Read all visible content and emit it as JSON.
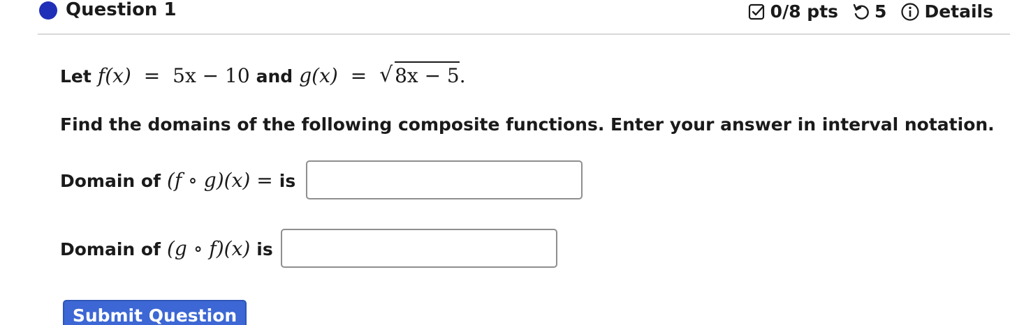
{
  "header": {
    "question_title": "Question 1",
    "points": "0/8 pts",
    "attempts": "5",
    "details": "Details"
  },
  "problem": {
    "intro_let": "Let",
    "f_lhs": "f(x)",
    "eq": "=",
    "f_rhs": "5x − 10",
    "and": "and",
    "g_lhs": "g(x)",
    "g_rhs_radicand": "8x − 5",
    "period": ".",
    "instruction": "Find the domains of the following composite functions. Enter your answer in interval notation."
  },
  "questions": [
    {
      "prefix": "Domain of",
      "expr": "(f ∘ g)(x)",
      "eq": "=",
      "suffix": "is",
      "value": ""
    },
    {
      "prefix": "Domain of",
      "expr": "(g ∘ f)(x)",
      "suffix": "is",
      "value": ""
    }
  ],
  "actions": {
    "submit_label": "Submit Question"
  },
  "colors": {
    "question_dot": "#1f2fb8",
    "submit_bg": "#3c67d4",
    "divider": "#d9d9d9"
  }
}
